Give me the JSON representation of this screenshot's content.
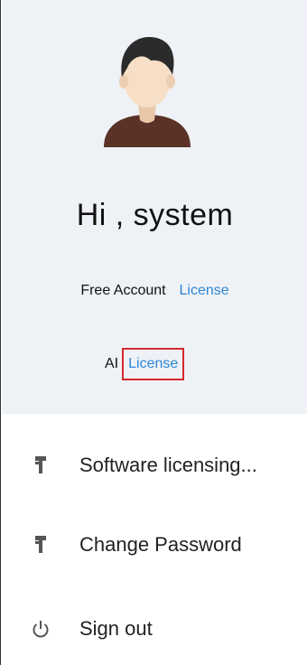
{
  "header": {
    "greeting": "Hi , system",
    "account_type": "Free Account",
    "account_license_link": "License",
    "ai_label": "AI",
    "ai_license_link": "License"
  },
  "menu": {
    "items": [
      {
        "label": "Software licensing...",
        "icon": "key-icon"
      },
      {
        "label": "Change Password",
        "icon": "key-icon"
      },
      {
        "label": "Sign out",
        "icon": "power-icon"
      }
    ]
  },
  "colors": {
    "header_bg": "#eef2f6",
    "link": "#2f87d6",
    "highlight_border": "#d9282f"
  }
}
